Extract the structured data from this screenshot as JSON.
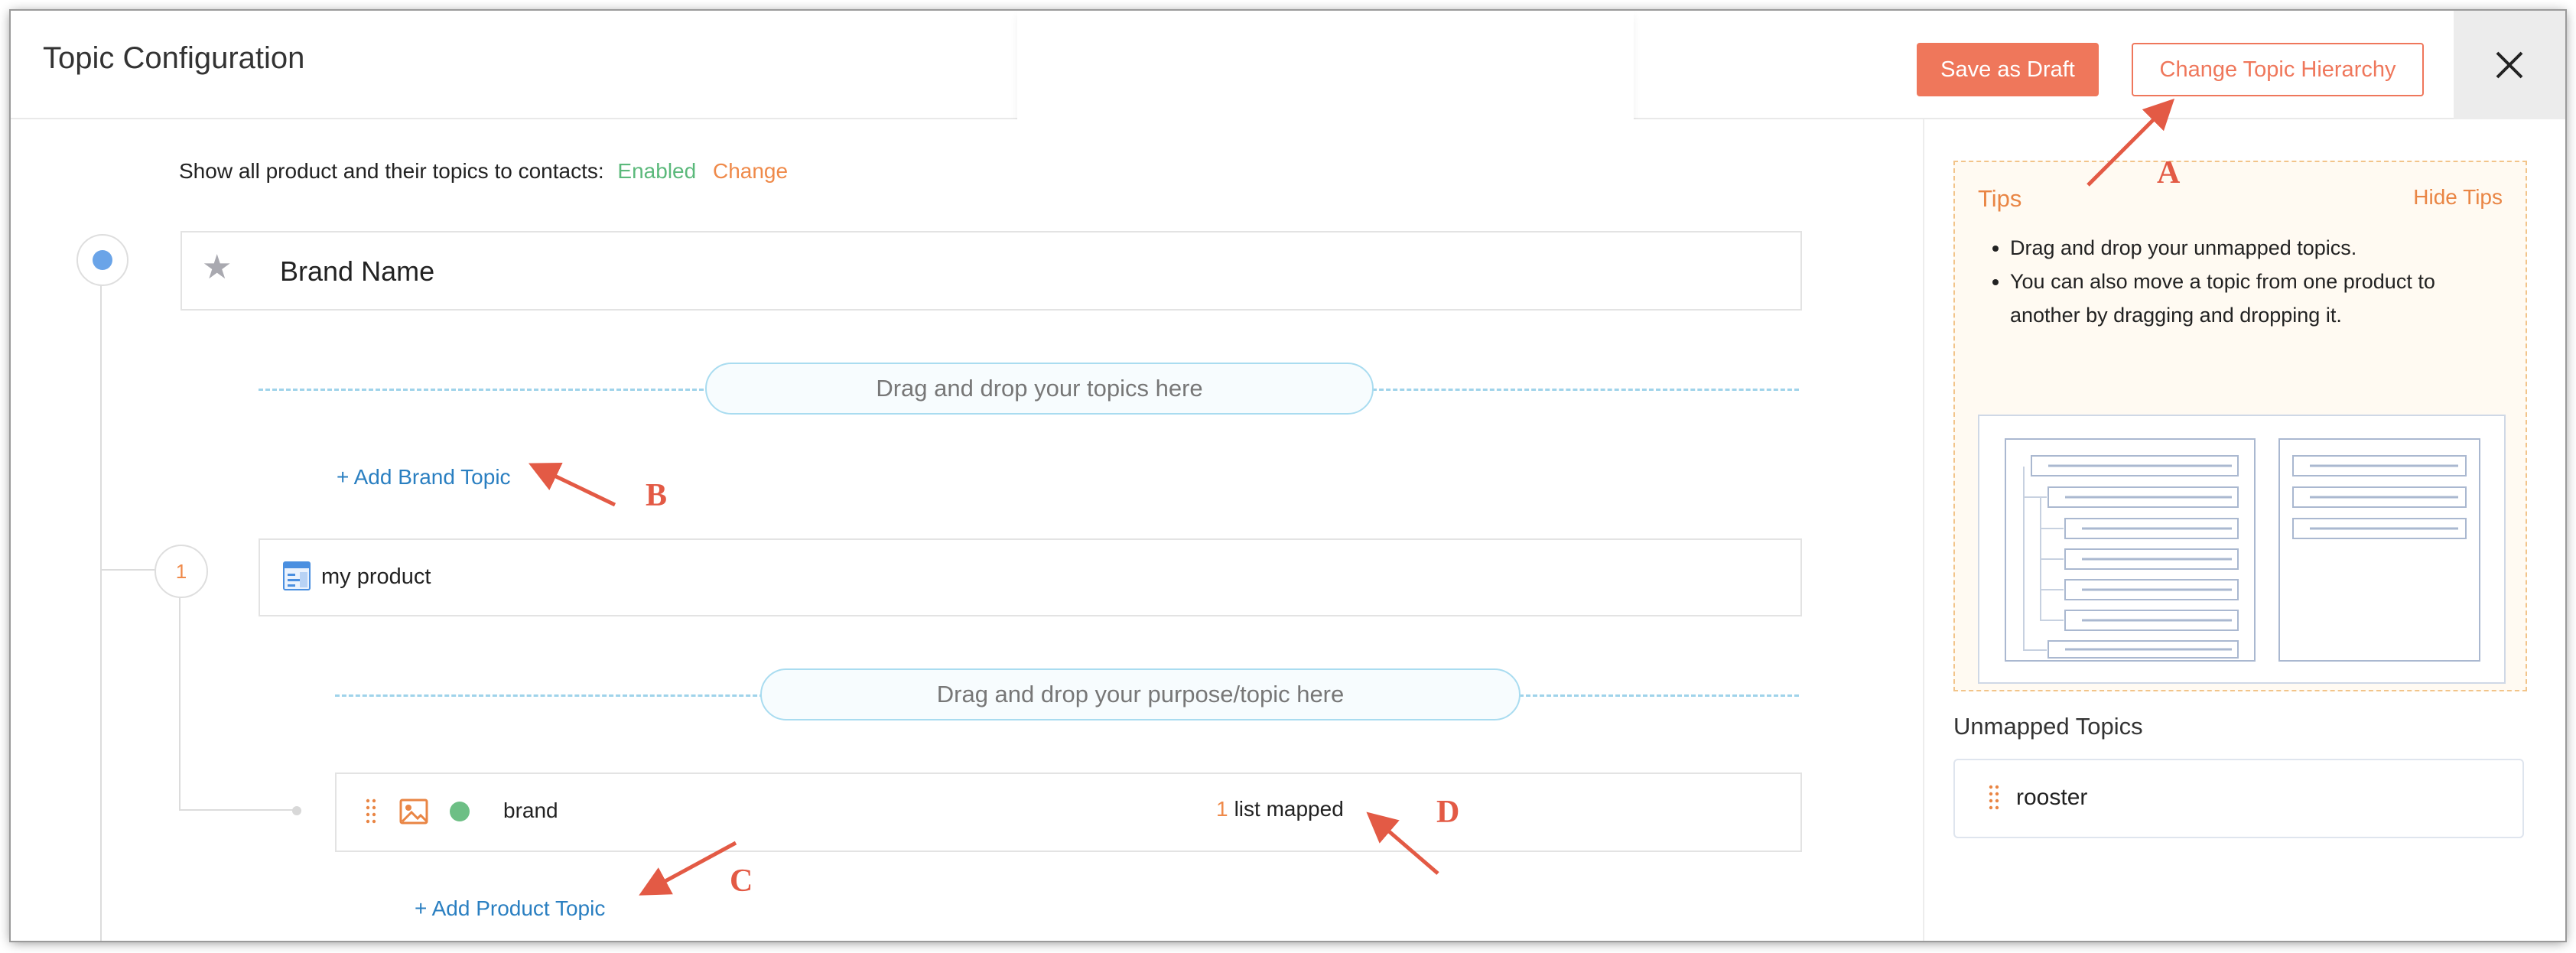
{
  "header": {
    "title": "Topic Configuration",
    "save_draft": "Save as Draft",
    "change_hierarchy": "Change Topic Hierarchy",
    "close_icon": "close-icon"
  },
  "settings": {
    "label": "Show all product and their topics to contacts:",
    "status": "Enabled",
    "change": "Change"
  },
  "brand": {
    "name": "Brand Name",
    "icon": "star-icon",
    "drop_hint": "Drag and drop your topics here",
    "add_topic": "Add Brand Topic"
  },
  "product": {
    "index": "1",
    "name": "my product",
    "icon": "product-icon",
    "drop_hint": "Drag and drop your purpose/topic here",
    "add_topic": "Add Product Topic"
  },
  "topic": {
    "name": "brand",
    "mapped_count": "1",
    "mapped_text": "list mapped",
    "status_color": "#6dbf85"
  },
  "tips": {
    "title": "Tips",
    "hide": "Hide Tips",
    "items": [
      "Drag and drop your unmapped topics.",
      "You can also move a topic from one product to another by dragging and dropping it."
    ]
  },
  "unmapped": {
    "title": "Unmapped Topics",
    "items": [
      "rooster"
    ]
  },
  "annotations": {
    "a": "A",
    "b": "B",
    "c": "C",
    "d": "D"
  },
  "colors": {
    "accent": "#ef775b",
    "link": "#2a7fc1",
    "enabled": "#5bb97b",
    "annotation": "#e35a45"
  }
}
